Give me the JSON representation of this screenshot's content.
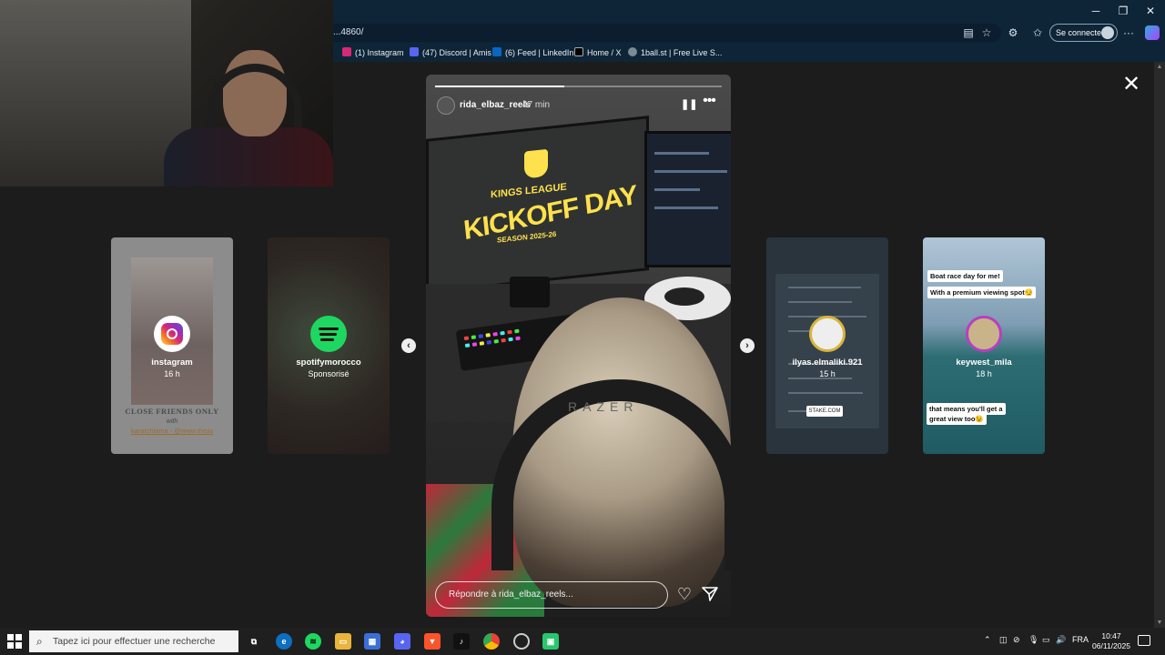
{
  "browser": {
    "url": "...4860/",
    "sign_in_label": "Se connecter",
    "bookmarks": [
      {
        "label": "(1) Instagram",
        "color": "#d62976"
      },
      {
        "label": "(47) Discord | Amis",
        "color": "#5865f2"
      },
      {
        "label": "(6) Feed | LinkedIn",
        "color": "#0a66c2"
      },
      {
        "label": "Home / X",
        "color": "#000000"
      },
      {
        "label": "1ball.st | Free Live S...",
        "color": "#7a8a96"
      }
    ]
  },
  "story": {
    "username": "rida_elbaz_reels",
    "time": "47 min",
    "progress": 0.45,
    "scene_text": {
      "league": "KINGS LEAGUE",
      "headline": "KICKOFF DAY",
      "season": "SEASON 2025-26",
      "headphones": "RAZER"
    },
    "reply_placeholder": "Répondre à rida_elbaz_reels..."
  },
  "cards": [
    {
      "name": "instagram",
      "time": "16 h",
      "caption_title": "CLOSE FRIENDS ONLY",
      "caption_with": "with",
      "caption_who": "karatchlama - @www.thisis",
      "icon": "instagram-icon"
    },
    {
      "name": "spotifymorocco",
      "time": "Sponsorisé",
      "icon": "spotify-icon"
    },
    {
      "name": "ilyas.elmaliki.921",
      "time": "15 h",
      "stake_label": "STAKE.COM"
    },
    {
      "name": "keywest_mila",
      "time": "18 h",
      "captions": [
        "Boat race day for me!",
        "With a premium viewing spot😏",
        "that means you'll get a",
        "great view too😉"
      ]
    }
  ],
  "taskbar": {
    "search_placeholder": "Tapez ici pour effectuer une recherche",
    "language": "FRA",
    "time": "10:47",
    "date": "06/11/2025"
  },
  "colors": {
    "accent": "#0e2538",
    "kings_yellow": "#ffe14d",
    "spotify_green": "#1ed760"
  }
}
